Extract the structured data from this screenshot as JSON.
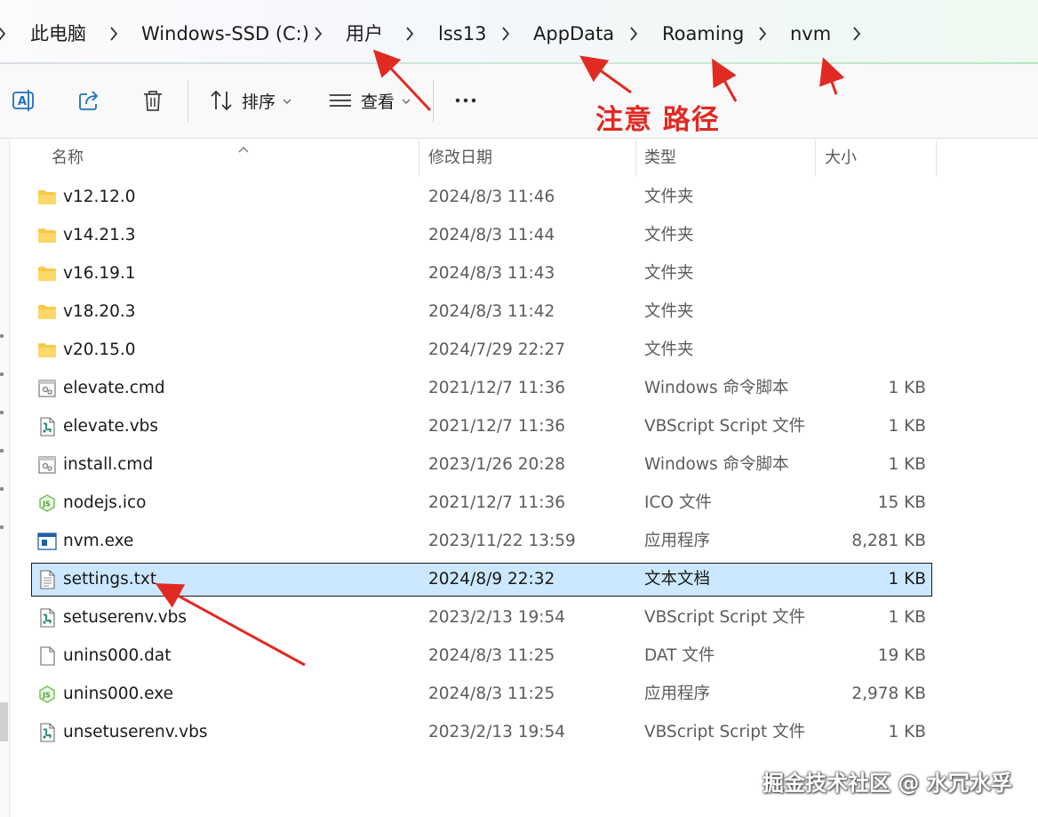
{
  "breadcrumb": {
    "items": [
      "此电脑",
      "Windows-SSD (C:)",
      "用户",
      "lss13",
      "AppData",
      "Roaming",
      "nvm"
    ]
  },
  "toolbar": {
    "rename_icon": "rename-icon",
    "share_icon": "share-icon",
    "delete_icon": "trash-icon",
    "sort_label": "排序",
    "view_label": "查看",
    "more_label": "···"
  },
  "annotation": {
    "note": "注意 路径",
    "color": "#e02a22"
  },
  "columns": {
    "name": "名称",
    "date": "修改日期",
    "type": "类型",
    "size": "大小"
  },
  "files": [
    {
      "name": "v12.12.0",
      "date": "2024/8/3 11:46",
      "type": "文件夹",
      "size": "",
      "icon": "folder-icon"
    },
    {
      "name": "v14.21.3",
      "date": "2024/8/3 11:44",
      "type": "文件夹",
      "size": "",
      "icon": "folder-icon"
    },
    {
      "name": "v16.19.1",
      "date": "2024/8/3 11:43",
      "type": "文件夹",
      "size": "",
      "icon": "folder-icon"
    },
    {
      "name": "v18.20.3",
      "date": "2024/8/3 11:42",
      "type": "文件夹",
      "size": "",
      "icon": "folder-icon"
    },
    {
      "name": "v20.15.0",
      "date": "2024/7/29 22:27",
      "type": "文件夹",
      "size": "",
      "icon": "folder-icon"
    },
    {
      "name": "elevate.cmd",
      "date": "2021/12/7 11:36",
      "type": "Windows 命令脚本",
      "size": "1 KB",
      "icon": "cmd-file-icon"
    },
    {
      "name": "elevate.vbs",
      "date": "2021/12/7 11:36",
      "type": "VBScript Script 文件",
      "size": "1 KB",
      "icon": "vbs-file-icon"
    },
    {
      "name": "install.cmd",
      "date": "2023/1/26 20:28",
      "type": "Windows 命令脚本",
      "size": "1 KB",
      "icon": "cmd-file-icon"
    },
    {
      "name": "nodejs.ico",
      "date": "2021/12/7 11:36",
      "type": "ICO 文件",
      "size": "15 KB",
      "icon": "nodejs-icon"
    },
    {
      "name": "nvm.exe",
      "date": "2023/11/22 13:59",
      "type": "应用程序",
      "size": "8,281 KB",
      "icon": "exe-file-icon"
    },
    {
      "name": "settings.txt",
      "date": "2024/8/9 22:32",
      "type": "文本文档",
      "size": "1 KB",
      "icon": "text-file-icon",
      "selected": true
    },
    {
      "name": "setuserenv.vbs",
      "date": "2023/2/13 19:54",
      "type": "VBScript Script 文件",
      "size": "1 KB",
      "icon": "vbs-file-icon"
    },
    {
      "name": "unins000.dat",
      "date": "2024/8/3 11:25",
      "type": "DAT 文件",
      "size": "19 KB",
      "icon": "blank-file-icon"
    },
    {
      "name": "unins000.exe",
      "date": "2024/8/3 11:25",
      "type": "应用程序",
      "size": "2,978 KB",
      "icon": "nodejs-icon"
    },
    {
      "name": "unsetuserenv.vbs",
      "date": "2023/2/13 19:54",
      "type": "VBScript Script 文件",
      "size": "1 KB",
      "icon": "vbs-file-icon"
    }
  ],
  "watermark": "掘金技术社区 @ 水冗水孚",
  "colors": {
    "selection_bg": "#cce8ff",
    "folder": "#f7c948",
    "annotation_red": "#e02a22"
  }
}
